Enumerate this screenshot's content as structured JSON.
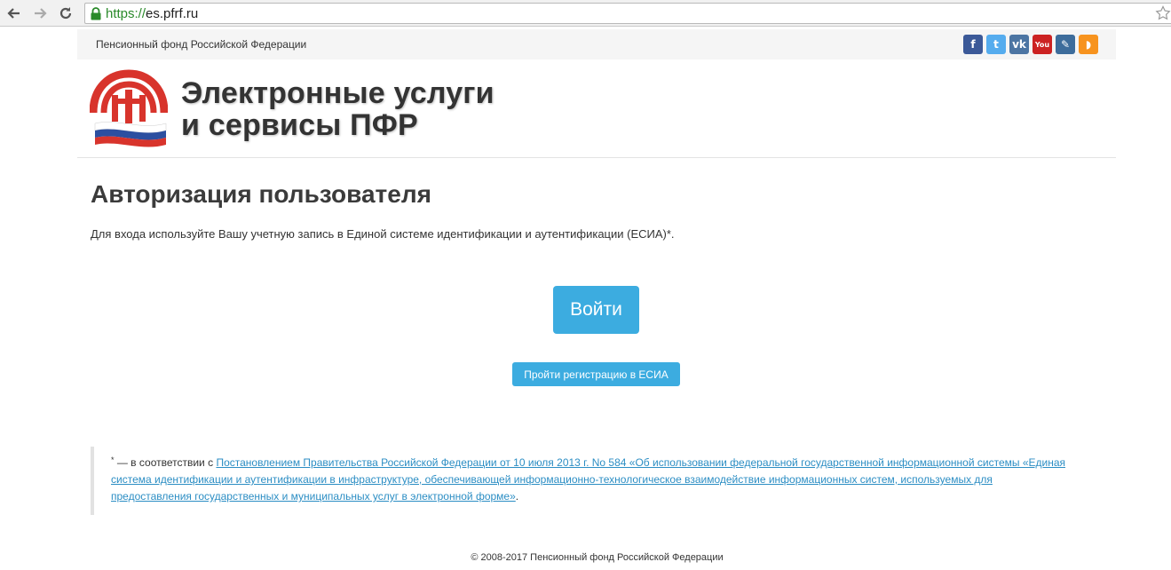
{
  "browser": {
    "url_scheme": "https://",
    "url_host": "es.pfrf.ru"
  },
  "topbar": {
    "org_name": "Пенсионный фонд Российской Федерации",
    "socials": [
      {
        "name": "facebook",
        "glyph": "f",
        "color": "#3b5998"
      },
      {
        "name": "twitter",
        "glyph": "t",
        "color": "#55acee"
      },
      {
        "name": "vkontakte",
        "glyph": "vk",
        "color": "#4c75a3"
      },
      {
        "name": "youtube",
        "glyph": "You",
        "color": "#cc2222"
      },
      {
        "name": "livejournal",
        "glyph": "✎",
        "color": "#3d6c9b"
      },
      {
        "name": "rss",
        "glyph": "◗",
        "color": "#f7931e"
      }
    ]
  },
  "header": {
    "title_line1": "Электронные услуги",
    "title_line2": "и сервисы ПФР"
  },
  "main": {
    "title": "Авторизация пользователя",
    "intro": "Для входа используйте Вашу учетную запись в Единой системе идентификации и аутентификации (ЕСИА)*.",
    "login_label": "Войти",
    "register_label": "Пройти регистрацию в ЕСИА"
  },
  "footnote": {
    "marker": "*",
    "prefix": " — в соответствии с ",
    "link_text": "Постановлением Правительства Российской Федерации от 10 июля 2013 г. No 584 «Об использовании федеральной государственной информационной системы «Единая система идентификации и аутентификации в инфраструктуре, обеспечивающей информационно-технологическое взаимодействие информационных систем, используемых для предоставления государственных и муниципальных услуг в электронной форме»",
    "suffix": "."
  },
  "footer": {
    "copyright": "© 2008-2017 Пенсионный фонд Российской Федерации"
  },
  "colors": {
    "accent": "#3cace0",
    "link": "#2c8ec4",
    "logo_red": "#d8342c"
  }
}
